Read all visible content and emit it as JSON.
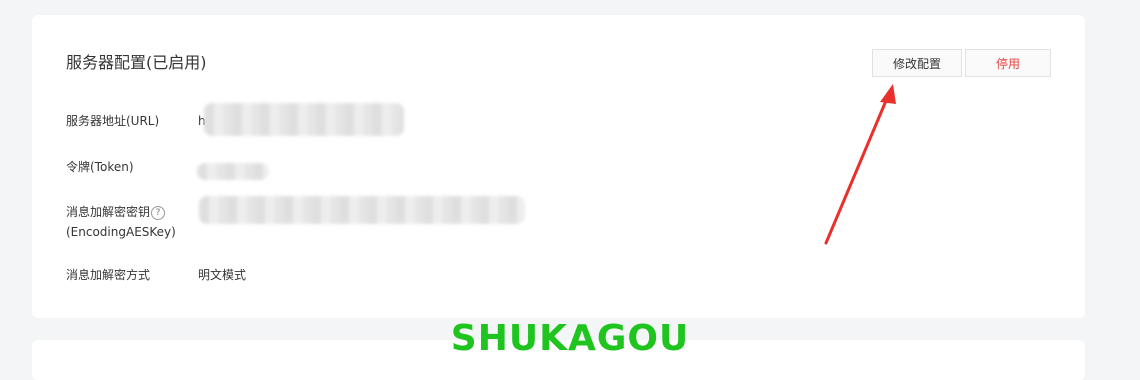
{
  "section": {
    "title": "服务器配置(已启用)",
    "edit_button": "修改配置",
    "disable_button": "停用"
  },
  "fields": {
    "url": {
      "label": "服务器地址(URL)",
      "value_visible_prefix": "h"
    },
    "token": {
      "label": "令牌(Token)"
    },
    "aes_key": {
      "label_line1": "消息加解密密钥",
      "label_line2": "(EncodingAESKey)",
      "help_icon_text": "?"
    },
    "mode": {
      "label": "消息加解密方式",
      "value": "明文模式"
    }
  },
  "watermark": "SHUKAGOU",
  "colors": {
    "danger_text": "#e64340",
    "watermark": "#1fc41f",
    "arrow": "#e8302c"
  }
}
